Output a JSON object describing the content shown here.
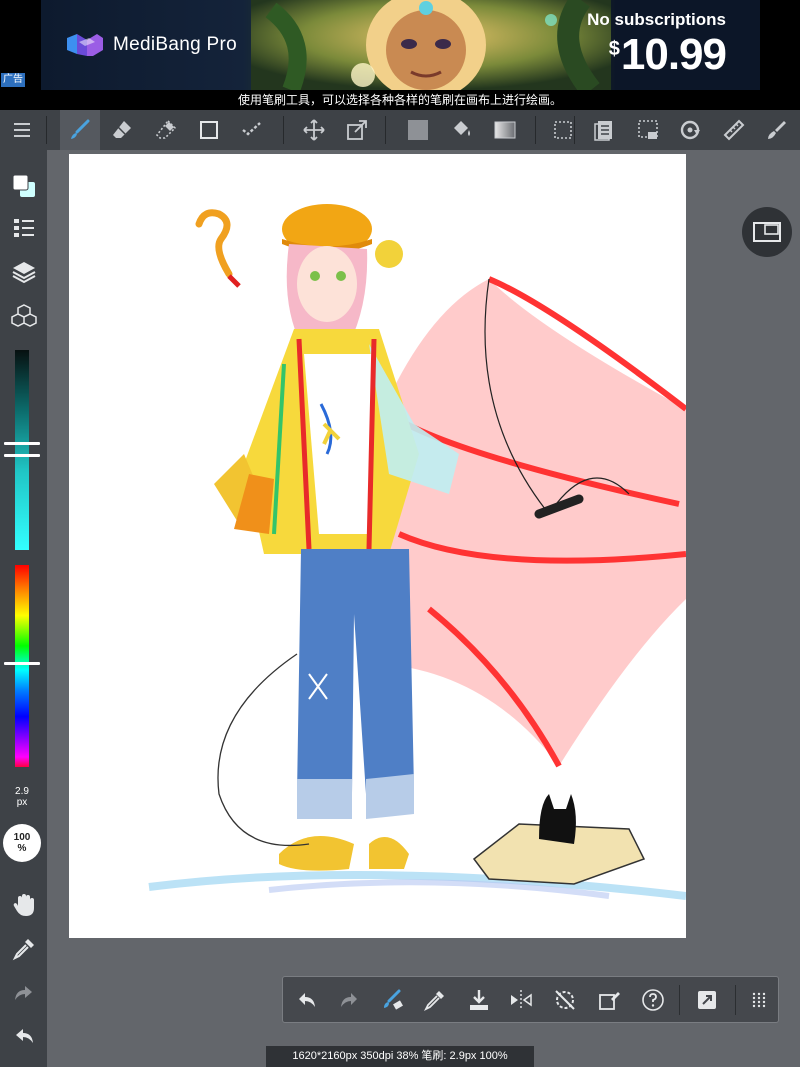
{
  "ad": {
    "brand": "MediBang Pro",
    "headline": "No subscriptions",
    "currency": "$",
    "price": "10.99",
    "tag": "广告"
  },
  "hint": "使用笔刷工具，可以选择各种各样的笔刷在画布上进行绘画。",
  "toolbar": {
    "items": [
      "menu-icon",
      "brush-icon",
      "eraser-icon",
      "dotted-eraser-icon",
      "rectangle-icon",
      "select-pen-icon",
      "move-icon",
      "transform-icon",
      "fill-color-icon",
      "bucket-icon",
      "gradient-icon",
      "marquee-icon",
      "layer-copy-icon",
      "dotted-select-icon",
      "rotate-icon",
      "ruler-icon",
      "pen-tip-icon"
    ],
    "active": "brush-icon"
  },
  "sidebar": {
    "brush_size": "2.9",
    "brush_size_unit": "px",
    "opacity": "100",
    "opacity_unit": "%",
    "color_accent": "#33ffff"
  },
  "status": {
    "text": "1620*2160px 350dpi 38% 笔刷: 2.9px 100%"
  },
  "colors": {
    "ui_panel": "#3e4247",
    "workspace": "#63666b",
    "accent": "#4aa3df"
  }
}
